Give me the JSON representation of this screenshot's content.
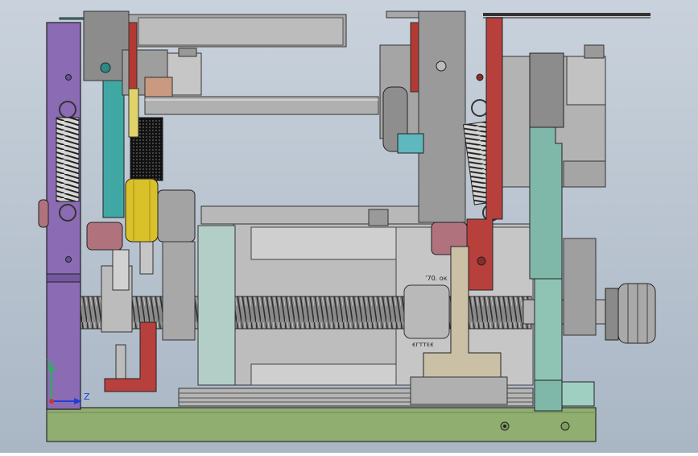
{
  "viewport": {
    "background_top": "#c9d2dc",
    "background_bottom": "#a9b6c4"
  },
  "triad": {
    "y_label": "Y",
    "z_label": "Z",
    "y_color": "#1db954",
    "z_color": "#1f3fd6"
  },
  "part_labels": {
    "motor_plate_upper": "’70. ок",
    "motor_plate_lower": "єгттεє"
  },
  "colors": {
    "base_plate": "#8fae6f",
    "left_frame": "#8b6bb3",
    "teal_arm": "#40a8a4",
    "red_arm": "#b8403c",
    "yellow_roller": "#d9c12a",
    "pink_roller": "#b0737e",
    "light_teal_link": "#7fb8a8",
    "gray_part": "#a9a9a9",
    "dark_gray": "#6e6e6e",
    "spring": "#3a3a3a",
    "beige_slider": "#c9c0a6"
  }
}
